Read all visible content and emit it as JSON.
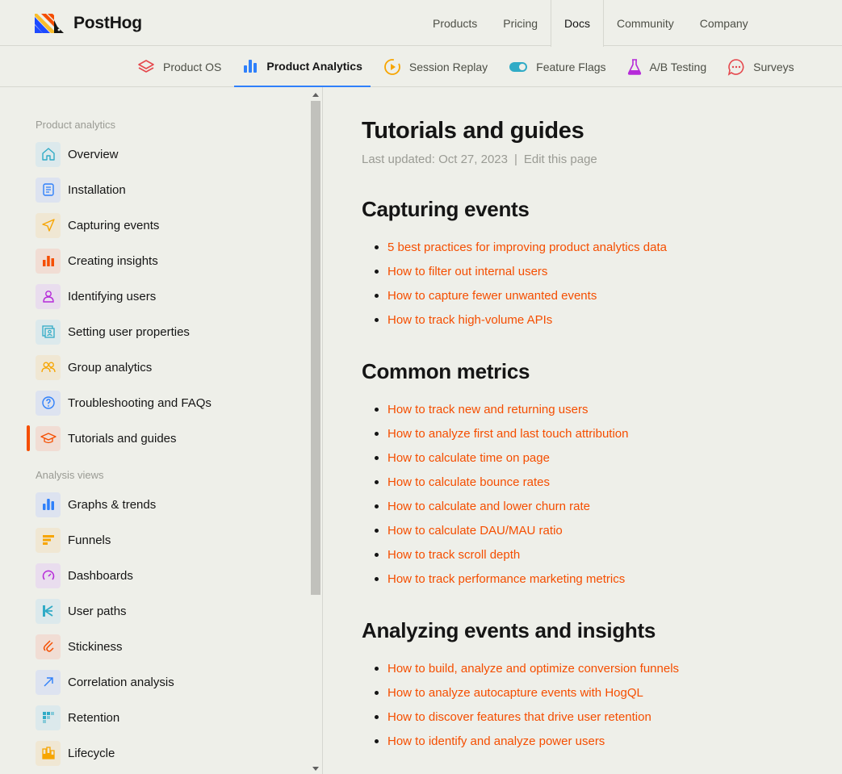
{
  "brand": {
    "name": "PostHog"
  },
  "top_nav": [
    {
      "label": "Products",
      "active": false
    },
    {
      "label": "Pricing",
      "active": false
    },
    {
      "label": "Docs",
      "active": true
    },
    {
      "label": "Community",
      "active": false
    },
    {
      "label": "Company",
      "active": false
    }
  ],
  "product_tabs": [
    {
      "label": "Product OS",
      "icon": "stack-icon",
      "active": false
    },
    {
      "label": "Product Analytics",
      "icon": "bar-chart-icon",
      "active": true
    },
    {
      "label": "Session Replay",
      "icon": "replay-icon",
      "active": false
    },
    {
      "label": "Feature Flags",
      "icon": "toggle-icon",
      "active": false
    },
    {
      "label": "A/B Testing",
      "icon": "flask-icon",
      "active": false
    },
    {
      "label": "Surveys",
      "icon": "chat-icon",
      "active": false
    }
  ],
  "sidebar": {
    "section1": "Product analytics",
    "items1": [
      {
        "label": "Overview",
        "icon": "home-icon"
      },
      {
        "label": "Installation",
        "icon": "document-icon"
      },
      {
        "label": "Capturing events",
        "icon": "send-icon"
      },
      {
        "label": "Creating insights",
        "icon": "bar-chart-icon"
      },
      {
        "label": "Identifying users",
        "icon": "user-icon"
      },
      {
        "label": "Setting user properties",
        "icon": "profile-card-icon"
      },
      {
        "label": "Group analytics",
        "icon": "users-icon"
      },
      {
        "label": "Troubleshooting and FAQs",
        "icon": "question-icon"
      },
      {
        "label": "Tutorials and guides",
        "icon": "graduation-cap-icon",
        "active": true
      }
    ],
    "section2": "Analysis views",
    "items2": [
      {
        "label": "Graphs & trends",
        "icon": "bar-chart-icon"
      },
      {
        "label": "Funnels",
        "icon": "funnel-icon"
      },
      {
        "label": "Dashboards",
        "icon": "gauge-icon"
      },
      {
        "label": "User paths",
        "icon": "paths-icon"
      },
      {
        "label": "Stickiness",
        "icon": "magnet-icon"
      },
      {
        "label": "Correlation analysis",
        "icon": "arrow-up-right-icon"
      },
      {
        "label": "Retention",
        "icon": "retention-icon"
      },
      {
        "label": "Lifecycle",
        "icon": "lifecycle-icon"
      }
    ]
  },
  "page": {
    "title": "Tutorials and guides",
    "last_updated": "Last updated: Oct 27, 2023",
    "separator": "|",
    "edit_label": "Edit this page"
  },
  "sections": [
    {
      "title": "Capturing events",
      "links": [
        "5 best practices for improving product analytics data",
        "How to filter out internal users",
        "How to capture fewer unwanted events",
        "How to track high-volume APIs"
      ]
    },
    {
      "title": "Common metrics",
      "links": [
        "How to track new and returning users",
        "How to analyze first and last touch attribution",
        "How to calculate time on page",
        "How to calculate bounce rates",
        "How to calculate and lower churn rate",
        "How to calculate DAU/MAU ratio",
        "How to track scroll depth",
        "How to track performance marketing metrics"
      ]
    },
    {
      "title": "Analyzing events and insights",
      "links": [
        "How to build, analyze and optimize conversion funnels",
        "How to analyze autocapture events with HogQL",
        "How to discover features that drive user retention",
        "How to identify and analyze power users"
      ]
    }
  ],
  "colors": {
    "accent": "#F54E00",
    "background": "#EEEFE9",
    "tab_underline": "#2F80FA"
  }
}
